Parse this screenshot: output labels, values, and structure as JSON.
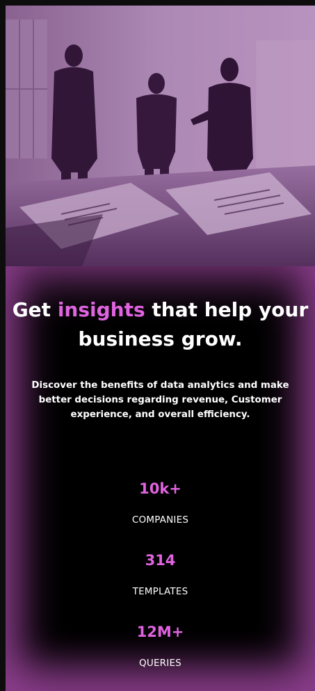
{
  "hero": {
    "image": "business-meeting-photo"
  },
  "headline": {
    "prefix": "Get ",
    "accent": "insights",
    "suffix": " that help your business grow."
  },
  "description": "Discover the benefits of data analytics and make better decisions regarding revenue, Customer experience, and overall efficiency.",
  "stats": [
    {
      "value": "10k+",
      "label": "COMPANIES"
    },
    {
      "value": "314",
      "label": "TEMPLATES"
    },
    {
      "value": "12M+",
      "label": "QUERIES"
    }
  ],
  "colors": {
    "accent": "#e063e0",
    "background": "#000000",
    "glow": "#c85ac8",
    "text": "#ffffff"
  }
}
